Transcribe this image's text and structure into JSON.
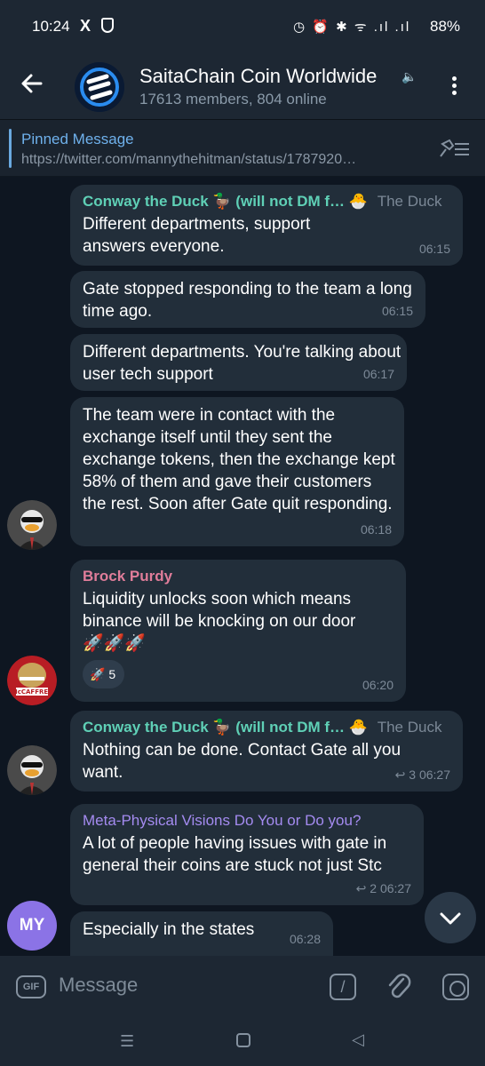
{
  "status_bar": {
    "time": "10:24",
    "x_icon": "X",
    "icons": "◷ ⏰ ✱ ᯤ .ıl .ıl",
    "battery": "88%"
  },
  "header": {
    "title": "SaitaChain Coin Worldwide",
    "subtitle": "17613 members, 804 online"
  },
  "pinned": {
    "label": "Pinned Message",
    "text": "https://twitter.com/mannythehitman/status/1787920…"
  },
  "messages": [
    {
      "sender": "Conway the Duck 🦆 (will not DM f…",
      "emoji": "🐣",
      "tag": "The Duck",
      "text": "Different departments, support answers everyone.",
      "time": "06:15"
    },
    {
      "text": "Gate stopped responding to the team a long time ago.",
      "time": "06:15"
    },
    {
      "text": "Different departments. You're talking about user tech support",
      "time": "06:17"
    },
    {
      "text": "The team were in contact with the exchange itself until they sent the exchange tokens, then the exchange kept 58% of them and gave their customers the rest. Soon after Gate quit responding.",
      "time": "06:18"
    },
    {
      "sender": "Brock Purdy",
      "text": "Liquidity unlocks soon which means binance will be knocking on our door",
      "emojis": "🚀🚀🚀",
      "reaction_emoji": "🚀",
      "reaction_count": "5",
      "time": "06:20"
    },
    {
      "sender": "Conway the Duck 🦆 (will not DM f…",
      "emoji": "🐣",
      "tag": "The Duck",
      "text": "Nothing can be done. Contact Gate all you want.",
      "replies": "↩ 3",
      "time": "06:27"
    },
    {
      "sender": "Meta-Physical Visions Do You or Do you?",
      "text": "A lot of people having issues with gate in general their coins are stuck not just Stc",
      "replies": "↩ 2",
      "time": "06:27"
    },
    {
      "text": "Especially in the states",
      "time": "06:28"
    }
  ],
  "avatars": {
    "my_initials": "MY"
  },
  "input": {
    "gif_label": "GIF",
    "placeholder": "Message",
    "command_label": "/"
  },
  "navbar": {
    "menu": "☰",
    "back": "◁"
  },
  "colors": {
    "accent": "#6fb1ec",
    "bubble": "#222e3a",
    "background": "#0e1621",
    "teal_name": "#5fd0b6",
    "pink_name": "#e07d9a",
    "violet_name": "#a48bf0"
  }
}
